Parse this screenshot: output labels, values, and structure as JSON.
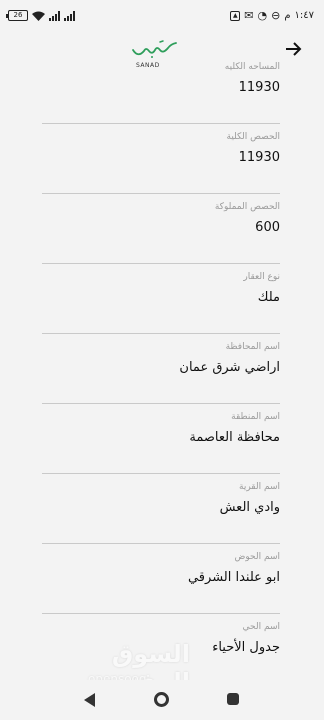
{
  "status_bar": {
    "time": "١:٤٧",
    "period": "م",
    "battery": "26",
    "icons": [
      "battery-icon",
      "wifi-icon",
      "signal-icon",
      "signal-icon",
      "gallery-icon",
      "message-icon",
      "whatsapp-icon",
      "do-not-disturb-icon"
    ]
  },
  "header": {
    "logo_caption": "SANAD",
    "back_icon": "arrow-right-icon"
  },
  "fields": [
    {
      "label": "المساحه الكليه",
      "value": "11930"
    },
    {
      "label": "الحصص الكلية",
      "value": "11930"
    },
    {
      "label": "الحصص المملوكة",
      "value": "600"
    },
    {
      "label": "نوع العقار",
      "value": "ملك"
    },
    {
      "label": "اسم المحافظة",
      "value": "اراضي شرق عمان"
    },
    {
      "label": "اسم المنطقة",
      "value": "محافظة العاصمة"
    },
    {
      "label": "اسم القرية",
      "value": "وادي العش"
    },
    {
      "label": "اسم الحوض",
      "value": "ابو علندا الشرقي"
    },
    {
      "label": "اسم الحي",
      "value": "جدول الأحياء"
    }
  ],
  "watermark": {
    "arabic": "السوق المفتوح",
    "english": "opensooq"
  },
  "colors": {
    "background": "#f3f3f3",
    "divider": "#c9c9c9",
    "label": "#9a9a9a",
    "logo": "#2e9e5b"
  }
}
